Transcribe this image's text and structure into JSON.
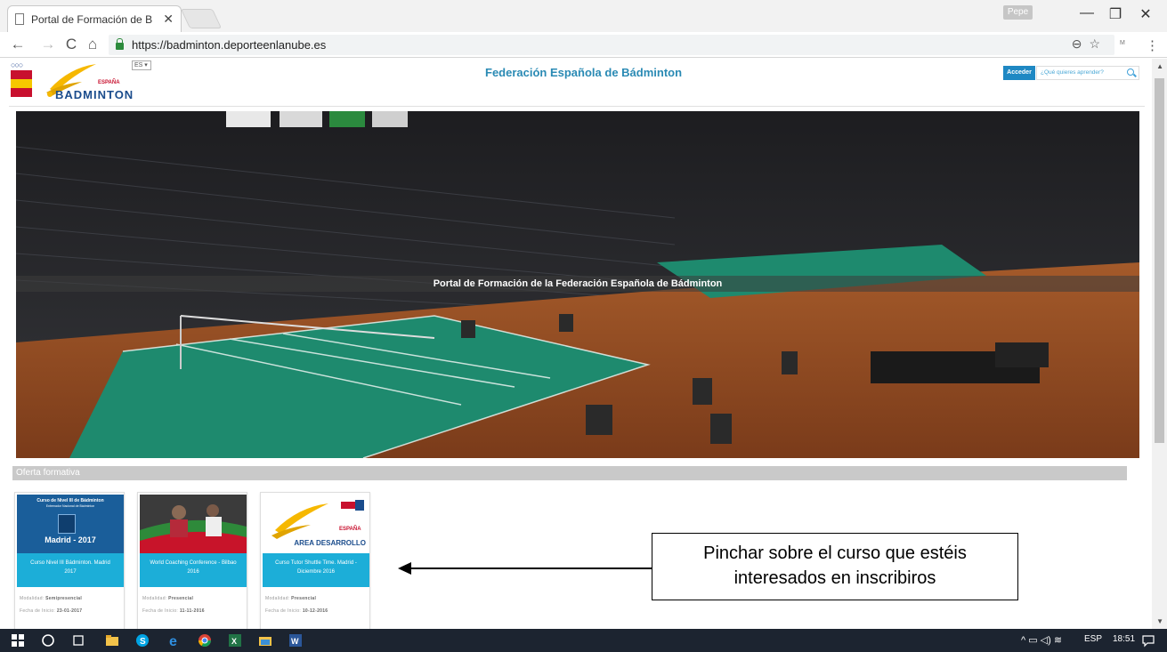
{
  "browser": {
    "tab_title": "Portal de Formación de B",
    "tab_close": "✕",
    "user": "Pepe",
    "url": "https://badminton.deporteenlanube.es",
    "omni_icons": "⊖☆",
    "ext": "M",
    "menu": "⋮",
    "window_buttons": {
      "minimize": "—",
      "restore": "❐",
      "close": "✕"
    },
    "nav": {
      "back": "←",
      "forward": "→",
      "reload": "C",
      "home": "⌂"
    }
  },
  "site": {
    "logo_text": "BADMINTON",
    "logo_espana": "ESPAÑA",
    "lang": "ES ▾",
    "title": "Federación Española de Bádminton",
    "login": "Acceder",
    "search_placeholder": "¿Qué quieres aprender?"
  },
  "hero": {
    "caption": "Portal de Formación de la Federación Española de Bádminton"
  },
  "section": {
    "title": "Oferta formativa"
  },
  "cards": [
    {
      "thumb_line1": "Curso de Nivel III de Bádminton",
      "thumb_line2": "Entrenador Nacional de Bádminton",
      "thumb_line3": "Madrid - 2017",
      "title": "Curso Nivel III Bádminton. Madrid 2017",
      "modalidad_label": "Modalidad:",
      "modalidad": "Semipresencial",
      "fecha_label": "Fecha de Inicio:",
      "fecha": "23-01-2017"
    },
    {
      "title": "World Coaching Conference - Bilbao 2016",
      "modalidad_label": "Modalidad:",
      "modalidad": "Presencial",
      "fecha_label": "Fecha de Inicio:",
      "fecha": "11-11-2016"
    },
    {
      "thumb_line1": "ESPAÑA",
      "thumb_line2": "AREA DESARROLLO",
      "title": "Curso Tutor Shuttle Time. Madrid - Diciembre 2016",
      "modalidad_label": "Modalidad:",
      "modalidad": "Presencial",
      "fecha_label": "Fecha de Inicio:",
      "fecha": "10-12-2016"
    }
  ],
  "annotation": {
    "line1": "Pinchar sobre el curso que estéis",
    "line2": "interesados en inscribiros"
  },
  "taskbar": {
    "lang": "ESP",
    "time": "18:51",
    "tray": "^ ▭ ◁) ≋"
  }
}
